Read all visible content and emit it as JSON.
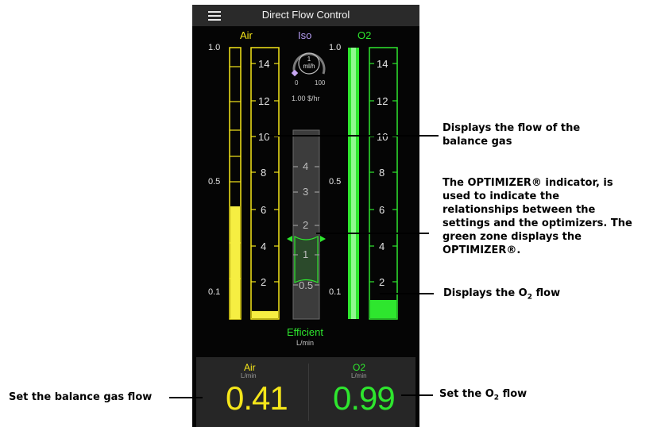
{
  "header": {
    "title": "Direct Flow Control",
    "menu_icon": "hamburger-menu-icon"
  },
  "flowmeters": {
    "air": {
      "label": "Air",
      "color": "#f5e61a",
      "log_ticks": [
        "1.0",
        "0.5",
        "0.1"
      ],
      "fill_log": 0.41,
      "scale": [
        "14",
        "12",
        "10",
        "8",
        "6",
        "4",
        "2"
      ],
      "fill": 0.41
    },
    "o2": {
      "label": "O2",
      "color": "#2ee62e",
      "log_ticks": [
        "1.0",
        "0.5",
        "0.1"
      ],
      "fill_log": 0.99,
      "scale": [
        "14",
        "12",
        "10",
        "8",
        "6",
        "4",
        "2"
      ],
      "fill": 0.99
    }
  },
  "iso": {
    "label": "Iso",
    "value": "1",
    "unit": "ml/h",
    "min": "0",
    "max": "100",
    "cost": "1.00 $/hr"
  },
  "optimizer": {
    "scale": [
      "4",
      "3",
      "2",
      "1",
      "0.5"
    ],
    "status": "Efficient",
    "unit": "L/min"
  },
  "bottom": {
    "air": {
      "label": "Air",
      "unit": "L/min",
      "value": "0.41"
    },
    "o2": {
      "label": "O2",
      "unit": "L/min",
      "value": "0.99"
    }
  },
  "annotations": {
    "balance_gas": [
      "Displays the flow of the",
      "balance gas"
    ],
    "optimizer": [
      "The OPTIMIZER® indicator, is",
      "used to indicate the",
      "relationships between the",
      "settings and the optimizers. The",
      "green zone displays the",
      "OPTIMIZER®."
    ],
    "o2_flow": {
      "prefix": "Displays the O",
      "sub": "2",
      "suffix": " flow"
    },
    "set_balance": "Set the balance gas flow",
    "set_o2": {
      "prefix": "Set the O",
      "sub": "2",
      "suffix": " flow"
    }
  }
}
